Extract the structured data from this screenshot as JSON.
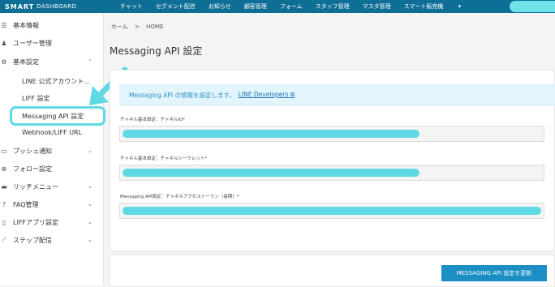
{
  "header": {
    "brand": "SMART",
    "brand_sub": "DASHBOARD",
    "nav": [
      "チャット",
      "セグメント配信",
      "お知らせ",
      "顧客管理",
      "フォーム",
      "スタッフ管理",
      "マスタ管理",
      "スマート販売機"
    ],
    "nav_dropdown_icon": "caret-down-icon"
  },
  "sidebar": {
    "items": [
      {
        "label": "基本情報",
        "icon": "list-icon"
      },
      {
        "label": "ユーザー管理",
        "icon": "users-icon"
      },
      {
        "label": "基本設定",
        "icon": "gear-icon",
        "expanded": true
      },
      {
        "label": "プッシュ通知",
        "icon": "bell-icon"
      },
      {
        "label": "フォロー設定",
        "icon": "follow-icon"
      },
      {
        "label": "リッチメニュー",
        "icon": "menu-icon"
      },
      {
        "label": "FAQ管理",
        "icon": "question-icon"
      },
      {
        "label": "LIFFアプリ設定",
        "icon": "app-icon"
      },
      {
        "label": "ステップ配信",
        "icon": "step-icon"
      }
    ],
    "subitems": [
      {
        "label": "LINE 公式アカウント..."
      },
      {
        "label": "LIFF 設定"
      },
      {
        "label": "Messaging API 設定",
        "active": true
      },
      {
        "label": "Webhook/LIFF URL"
      }
    ]
  },
  "main": {
    "breadcrumb": [
      "ホーム",
      "HOME"
    ],
    "breadcrumb_sep": ">",
    "title": "Messaging API 設定",
    "info_text": "Messaging API の情報を設定します。",
    "info_link": "LINE Developers",
    "fields": [
      {
        "label": "チャネル基本設定：チャネルID*"
      },
      {
        "label": "チャネル基本設定：チャネルシークレット*"
      },
      {
        "label": "Messaging API設定：チャネルアクセストークン（長期）*"
      }
    ],
    "update_button": "MESSAGING API 設定を更新"
  },
  "colors": {
    "topbar": "#0f6e96",
    "highlight": "#5fd9e4",
    "button": "#1b8ec3"
  }
}
